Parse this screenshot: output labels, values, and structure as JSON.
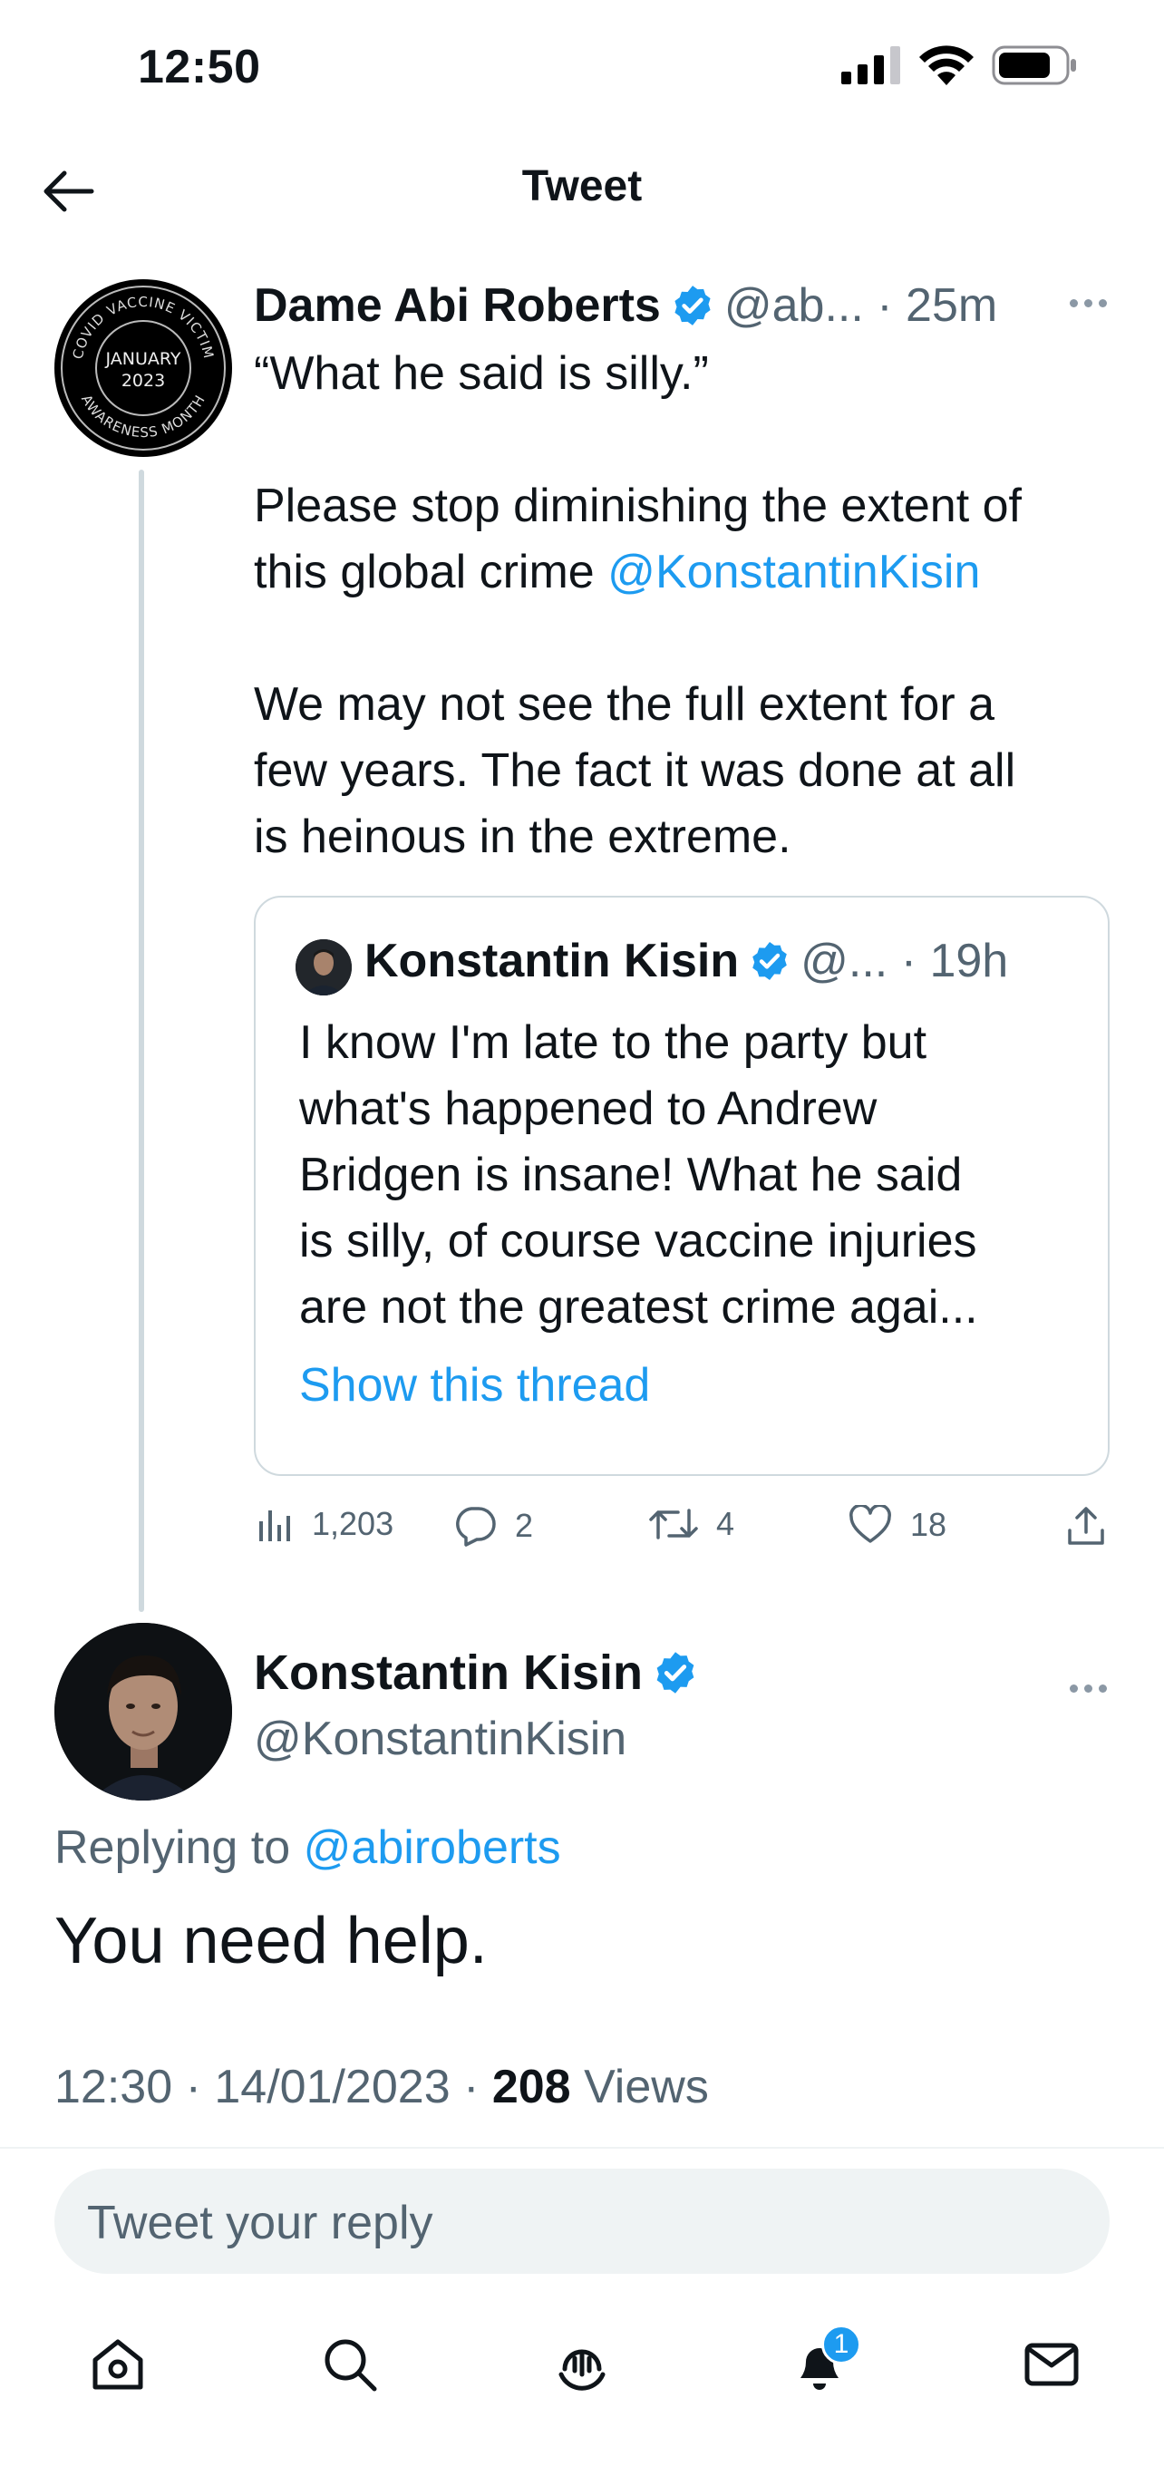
{
  "status_bar": {
    "time": "12:50"
  },
  "header": {
    "title": "Tweet"
  },
  "tweet1": {
    "name": "Dame Abi Roberts",
    "handle": "@ab...",
    "time": "25m",
    "avatar_text": {
      "top": "COVID VACCINE VICTIM",
      "center_line1": "JANUARY",
      "center_line2": "2023",
      "bottom": "AWARENESS MONTH"
    },
    "line1": "“What he said is silly.”",
    "line2a": "Please stop diminishing the extent of",
    "line2b": "this global crime",
    "mention": "@KonstantinKisin",
    "line3a": "We may not see the full extent for a",
    "line3b": "few years. The fact it was done at all",
    "line3c": "is heinous in the extreme.",
    "quote": {
      "name": "Konstantin Kisin",
      "handle": "@...",
      "time": "19h",
      "lines": [
        "I know I'm late to the party but",
        "what's happened to Andrew",
        "Bridgen is insane! What he said",
        "is silly, of course vaccine injuries",
        "are not the greatest crime agai..."
      ],
      "show_thread": "Show this thread"
    },
    "stats": {
      "views": "1,203",
      "replies": "2",
      "retweets": "4",
      "likes": "18"
    }
  },
  "tweet2": {
    "name": "Konstantin Kisin",
    "handle": "@KonstantinKisin",
    "replying_label": "Replying to",
    "replying_to": "@abiroberts",
    "text": "You need help.",
    "time": "12:30",
    "date": "14/01/2023",
    "views_count": "208",
    "views_label": "Views"
  },
  "reply": {
    "placeholder": "Tweet your reply"
  },
  "bottom_nav": {
    "notification_count": "1"
  },
  "colors": {
    "accent": "#1d9bf0",
    "text": "#0f1419",
    "secondary": "#536471",
    "border": "#cfd9de"
  }
}
